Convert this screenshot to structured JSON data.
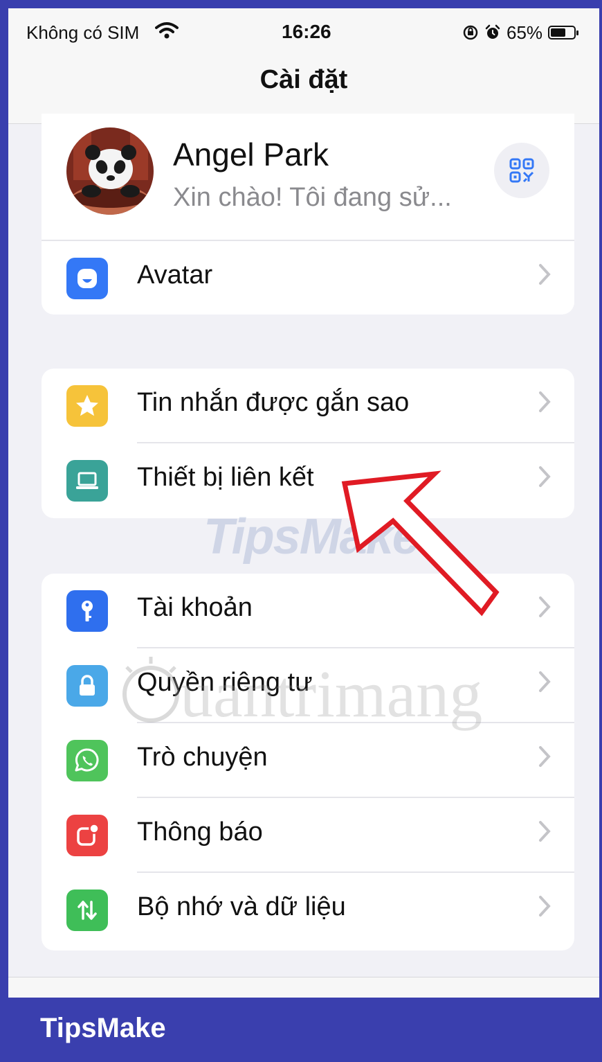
{
  "status_bar": {
    "carrier": "Không có SIM",
    "time": "16:26",
    "battery_percent": "65%",
    "battery_level": 0.65
  },
  "header": {
    "title": "Cài đặt"
  },
  "profile": {
    "name": "Angel Park",
    "status": "Xin chào! Tôi đang sử..."
  },
  "groups": [
    [
      {
        "label": "Avatar",
        "icon": "avatar-icon",
        "color": "#3478f6"
      }
    ],
    [
      {
        "label": "Tin nhắn được gắn sao",
        "icon": "star-icon",
        "color": "#f6c33a"
      },
      {
        "label": "Thiết bị liên kết",
        "icon": "laptop-icon",
        "color": "#3aa398"
      }
    ],
    [
      {
        "label": "Tài khoản",
        "icon": "key-icon",
        "color": "#2f6fee"
      },
      {
        "label": "Quyền riêng tư",
        "icon": "lock-icon",
        "color": "#4aa8e8"
      },
      {
        "label": "Trò chuyện",
        "icon": "whatsapp-icon",
        "color": "#4fc45b"
      },
      {
        "label": "Thông báo",
        "icon": "notification-icon",
        "color": "#ec4242"
      },
      {
        "label": "Bộ nhớ và dữ liệu",
        "icon": "storage-arrows-icon",
        "color": "#3fbe58"
      }
    ]
  ],
  "watermarks": {
    "primary": "TipsMake",
    "secondary": "uantrimang"
  },
  "brand": "TipsMake",
  "colors": {
    "frame": "#3a3fae",
    "annotation_arrow": "#e01b24"
  }
}
